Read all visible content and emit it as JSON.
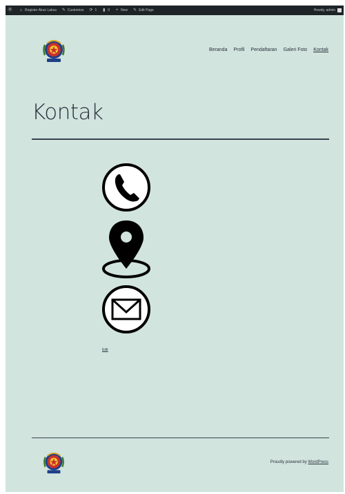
{
  "adminbar": {
    "site_name": "Register Akun Laksa",
    "customize": "Customize",
    "updates": "1",
    "comments": "0",
    "new": "New",
    "edit_page": "Edit Page",
    "howdy": "Howdy, admin"
  },
  "nav": {
    "items": [
      "Beranda",
      "Profil",
      "Pendaftaran",
      "Galeri Foto",
      "Kontak"
    ]
  },
  "page": {
    "title": "Kontak",
    "edit_link": "Edit"
  },
  "footer": {
    "powered_prefix": "Proudly powered by ",
    "powered_link": "WordPress"
  },
  "colors": {
    "background": "#d1e4dd",
    "text": "#28303d",
    "adminbar": "#1d2327"
  }
}
